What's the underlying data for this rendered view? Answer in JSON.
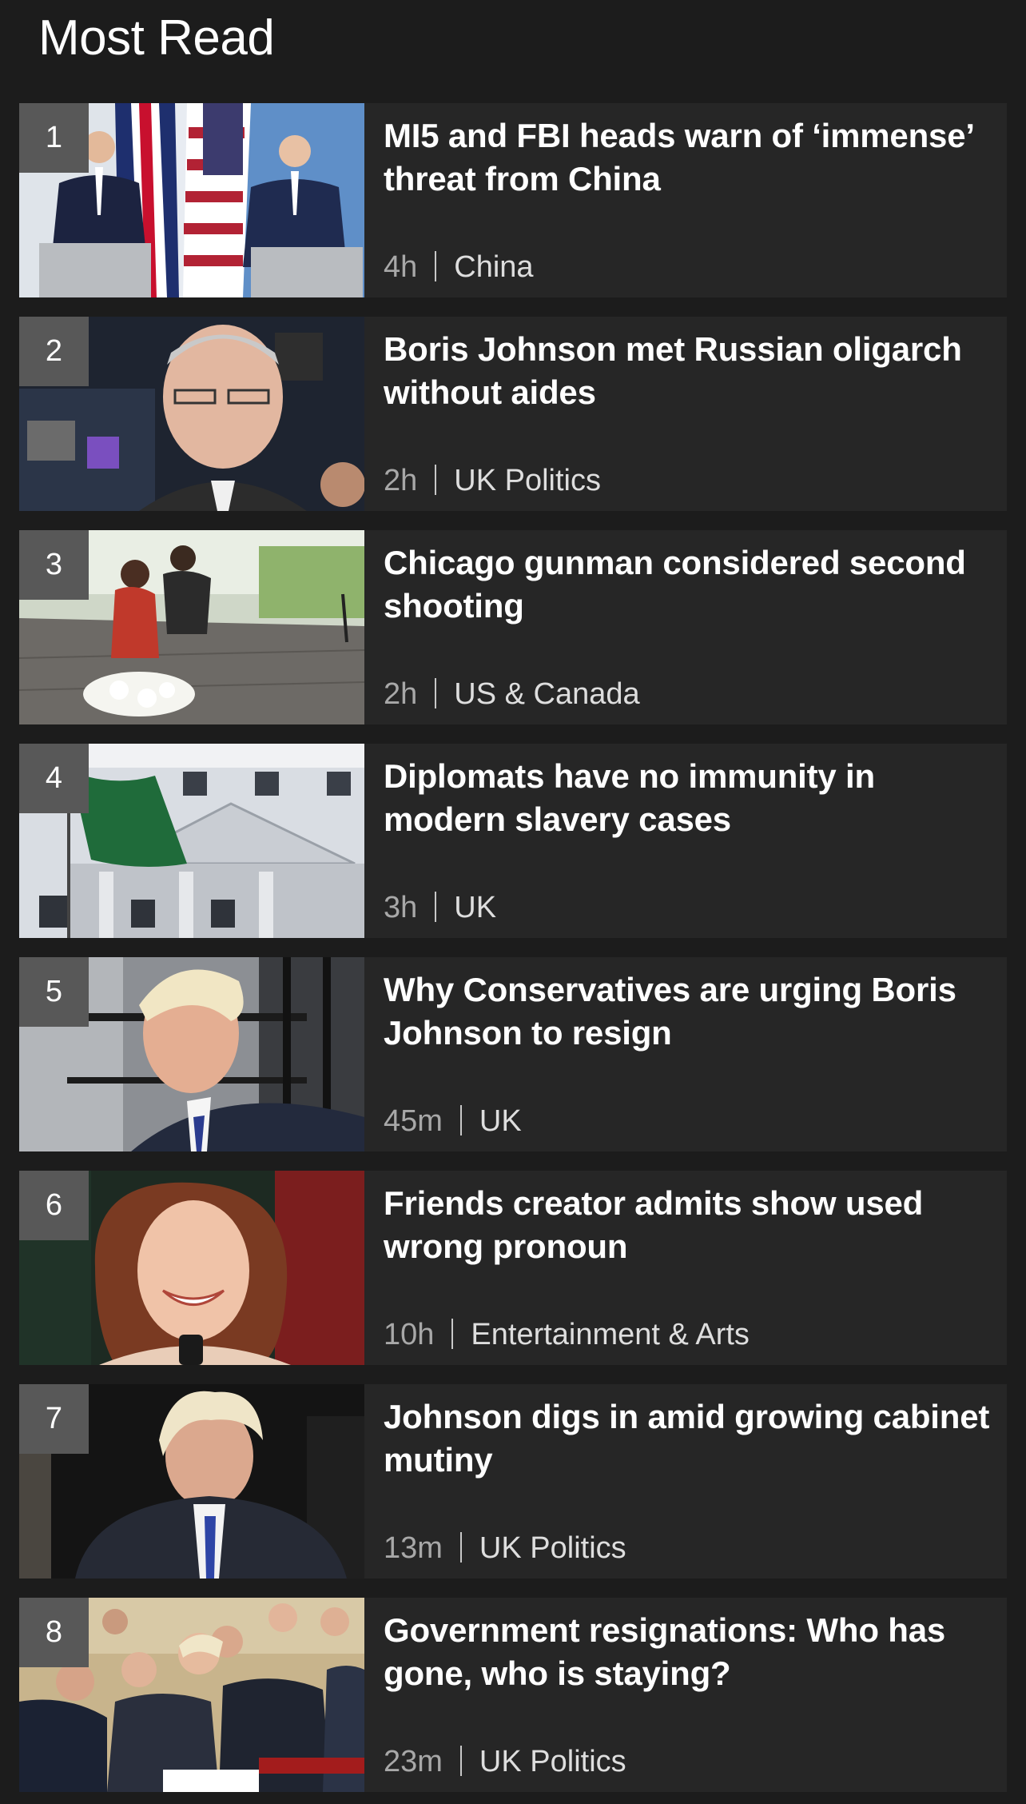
{
  "section": {
    "title": "Most Read"
  },
  "colors": {
    "background": "#1c1c1c",
    "card": "#262626",
    "rank_badge": "#585858",
    "meta_text": "#c8c8c8"
  },
  "stories": [
    {
      "rank": "1",
      "headline": "MI5 and FBI heads warn of ‘immense’ threat from China",
      "age": "4h",
      "topic": "China",
      "image": "mi5-fbi-heads-press-conference-photo"
    },
    {
      "rank": "2",
      "headline": "Boris Johnson met Russian oligarch without aides",
      "age": "2h",
      "topic": "UK Politics",
      "image": "russian-oligarch-portrait-photo"
    },
    {
      "rank": "3",
      "headline": "Chicago gunman considered second shooting",
      "age": "2h",
      "topic": "US & Canada",
      "image": "chicago-memorial-flowers-photo"
    },
    {
      "rank": "4",
      "headline": "Diplomats have no immunity in modern slavery cases",
      "age": "3h",
      "topic": "UK",
      "image": "saudi-embassy-building-photo"
    },
    {
      "rank": "5",
      "headline": "Why Conservatives are urging Boris Johnson to resign",
      "age": "45m",
      "topic": "UK",
      "image": "boris-johnson-profile-photo"
    },
    {
      "rank": "6",
      "headline": "Friends creator admits show used wrong pronoun",
      "age": "10h",
      "topic": "Entertainment & Arts",
      "image": "friends-creator-microphone-photo"
    },
    {
      "rank": "7",
      "headline": "Johnson digs in amid growing cabinet mutiny",
      "age": "13m",
      "topic": "UK Politics",
      "image": "boris-johnson-speaking-photo"
    },
    {
      "rank": "8",
      "headline": "Government resignations: Who has gone, who is staying?",
      "age": "23m",
      "topic": "UK Politics",
      "image": "cabinet-meeting-photo"
    }
  ]
}
